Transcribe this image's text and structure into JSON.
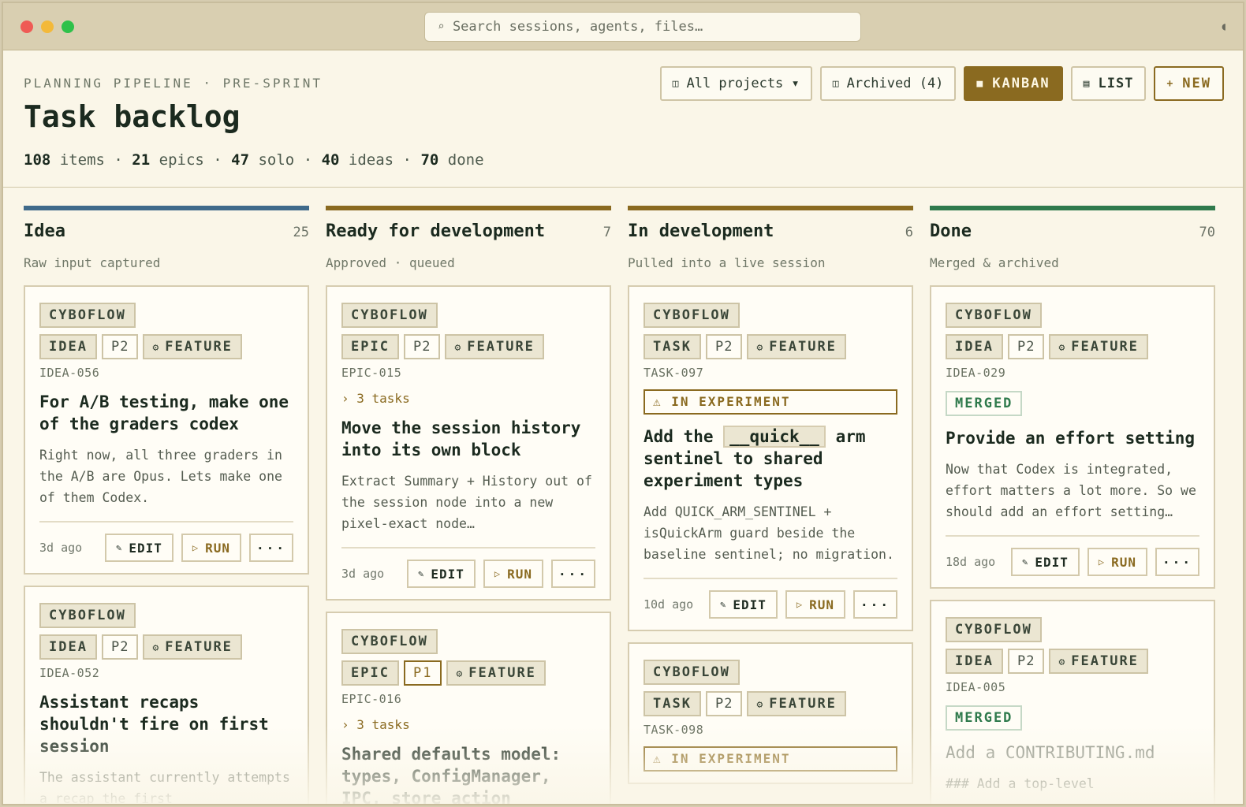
{
  "search": {
    "placeholder": "Search sessions, agents, files…"
  },
  "header": {
    "eyebrow": "PLANNING PIPELINE · PRE-SPRINT",
    "title": "Task backlog",
    "stats": [
      {
        "value": "108",
        "label": " items"
      },
      {
        "value": "21",
        "label": " epics"
      },
      {
        "value": "47",
        "label": " solo"
      },
      {
        "value": "40",
        "label": " ideas"
      },
      {
        "value": "70",
        "label": " done"
      }
    ],
    "sep": " · "
  },
  "toolbar": {
    "projects": "All projects ▾",
    "archived": "Archived (4)",
    "kanban": "KANBAN",
    "list": "LIST",
    "new": "NEW"
  },
  "colors": {
    "idea": "#3f6a8a",
    "ready": "#8a6a20",
    "dev": "#8a6a20",
    "done": "#2f7a4c"
  },
  "columns": [
    {
      "key": "idea",
      "title": "Idea",
      "count": "25",
      "sub": "Raw input captured",
      "cards": [
        {
          "project": "CYBOFLOW",
          "kind": "IDEA",
          "prio": "P2",
          "type": "FEATURE",
          "code": "IDEA-056",
          "title": "For A/B testing, make one of the graders codex",
          "body": "Right now, all three graders in the A/B are Opus. Lets make one of them Codex.",
          "age": "3d ago",
          "edit": "EDIT",
          "run": "RUN",
          "more": "···"
        },
        {
          "project": "CYBOFLOW",
          "kind": "IDEA",
          "prio": "P2",
          "type": "FEATURE",
          "code": "IDEA-052",
          "title": "Assistant recaps shouldn't fire on first session",
          "body": "The assistant currently attempts a recap the first"
        }
      ]
    },
    {
      "key": "ready",
      "title": "Ready for development",
      "count": "7",
      "sub": "Approved · queued",
      "cards": [
        {
          "project": "CYBOFLOW",
          "kind": "EPIC",
          "prio": "P2",
          "type": "FEATURE",
          "code": "EPIC-015",
          "tasks": "› 3 tasks",
          "title": "Move the session history into its own block",
          "body": "Extract Summary + History out of the session node into a new pixel-exact node…",
          "age": "3d ago",
          "edit": "EDIT",
          "run": "RUN",
          "more": "···"
        },
        {
          "project": "CYBOFLOW",
          "kind": "EPIC",
          "prio": "P1",
          "type": "FEATURE",
          "code": "EPIC-016",
          "tasks": "› 3 tasks",
          "title": "Shared defaults model: types, ConfigManager, IPC, store action"
        }
      ]
    },
    {
      "key": "dev",
      "title": "In development",
      "count": "6",
      "sub": "Pulled into a live session",
      "cards": [
        {
          "project": "CYBOFLOW",
          "kind": "TASK",
          "prio": "P2",
          "type": "FEATURE",
          "code": "TASK-097",
          "status": "IN EXPERIMENT",
          "title_a": "Add the ",
          "title_kw": "__quick__",
          "title_b": " arm sentinel to shared experiment types",
          "body": "Add QUICK_ARM_SENTINEL + isQuickArm guard beside the baseline sentinel; no migration.",
          "age": "10d ago",
          "edit": "EDIT",
          "run": "RUN",
          "more": "···"
        },
        {
          "project": "CYBOFLOW",
          "kind": "TASK",
          "prio": "P2",
          "type": "FEATURE",
          "code": "TASK-098",
          "status": "IN EXPERIMENT"
        }
      ]
    },
    {
      "key": "done",
      "title": "Done",
      "count": "70",
      "sub": "Merged & archived",
      "cards": [
        {
          "project": "CYBOFLOW",
          "kind": "IDEA",
          "prio": "P2",
          "type": "FEATURE",
          "code": "IDEA-029",
          "merged": "MERGED",
          "title": "Provide an effort setting",
          "body": "Now that Codex is integrated, effort matters a lot more. So we should add an effort setting…",
          "age": "18d ago",
          "edit": "EDIT",
          "run": "RUN",
          "more": "···"
        },
        {
          "project": "CYBOFLOW",
          "kind": "IDEA",
          "prio": "P2",
          "type": "FEATURE",
          "code": "IDEA-005",
          "merged": "MERGED",
          "title": "Add a CONTRIBUTING.md",
          "body": "### Add a top-level"
        }
      ]
    }
  ]
}
